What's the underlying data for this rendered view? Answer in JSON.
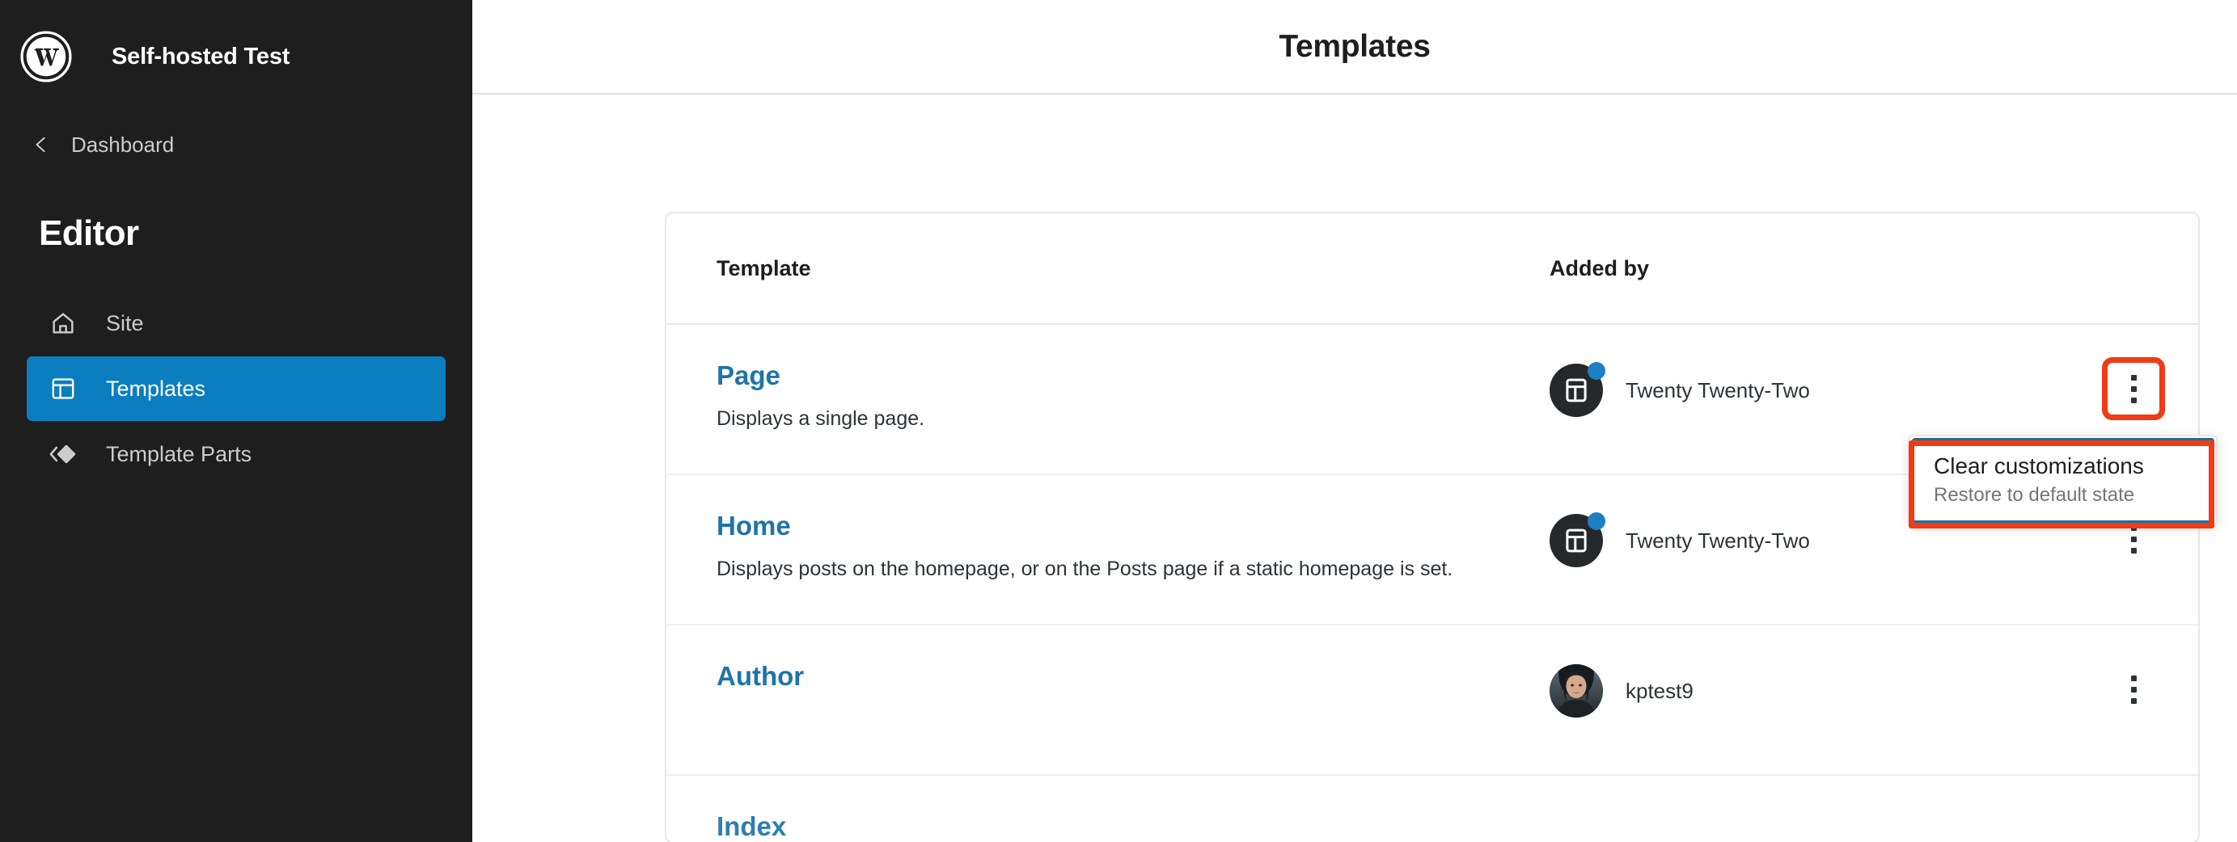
{
  "sidebar": {
    "logo_icon": "wordpress-logo-icon",
    "site_title": "Self-hosted Test",
    "back_link": {
      "label": "Dashboard",
      "icon": "chevron-left-icon"
    },
    "section_heading": "Editor",
    "items": [
      {
        "label": "Site",
        "icon": "home-icon",
        "active": false
      },
      {
        "label": "Templates",
        "icon": "template-layout-icon",
        "active": true
      },
      {
        "label": "Template Parts",
        "icon": "layers-diamond-icon",
        "active": false
      }
    ]
  },
  "header": {
    "title": "Templates"
  },
  "table": {
    "columns": {
      "template": "Template",
      "added_by": "Added by"
    },
    "rows": [
      {
        "name": "Page",
        "description": "Displays a single page.",
        "added_by": "Twenty Twenty-Two",
        "avatar_type": "theme",
        "avatar_icon": "template-layout-icon",
        "badge": true,
        "actions_icon": "kebab-menu-icon",
        "menu_open": true,
        "highlighted": true
      },
      {
        "name": "Home",
        "description": "Displays posts on the homepage, or on the Posts page if a static homepage is set.",
        "added_by": "Twenty Twenty-Two",
        "avatar_type": "theme",
        "avatar_icon": "template-layout-icon",
        "badge": true,
        "actions_icon": "kebab-menu-icon",
        "menu_open": false,
        "highlighted": false
      },
      {
        "name": "Author",
        "description": "",
        "added_by": "kptest9",
        "avatar_type": "user",
        "avatar_icon": "user-photo-avatar",
        "badge": false,
        "actions_icon": "kebab-menu-icon",
        "menu_open": false,
        "highlighted": false
      }
    ],
    "partial_row": {
      "name": "Index"
    }
  },
  "dropdown": {
    "items": [
      {
        "label": "Clear customizations",
        "description": "Restore to default state"
      }
    ]
  },
  "colors": {
    "sidebar_bg": "#1e1e1e",
    "accent_blue": "#0b7ec0",
    "link_blue": "#1e74a8",
    "highlight_red": "#f03b16",
    "focus_blue": "#1d6e94",
    "badge_blue": "#1d7ec4"
  }
}
